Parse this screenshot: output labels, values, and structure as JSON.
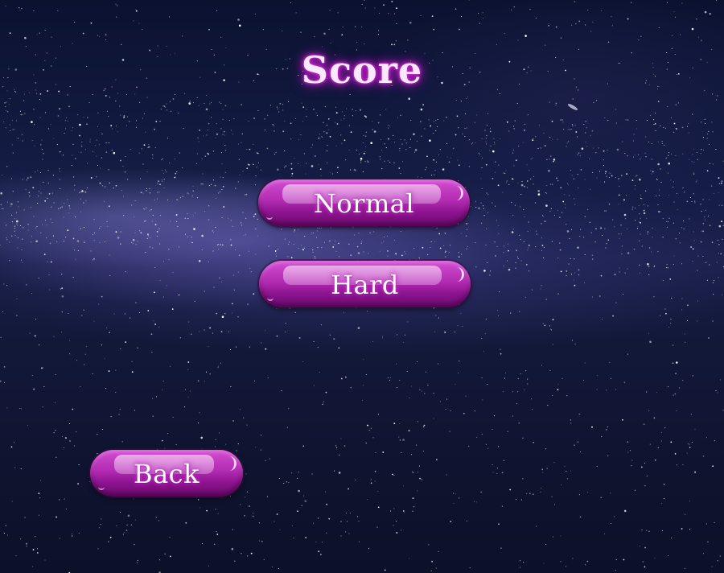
{
  "screen": {
    "title": "Score"
  },
  "menu": {
    "normal_label": "Normal",
    "hard_label": "Hard",
    "back_label": "Back"
  },
  "colors": {
    "button_fill": "#b22bb2",
    "title_glow": "#e02ad8",
    "background": "#141c44"
  }
}
